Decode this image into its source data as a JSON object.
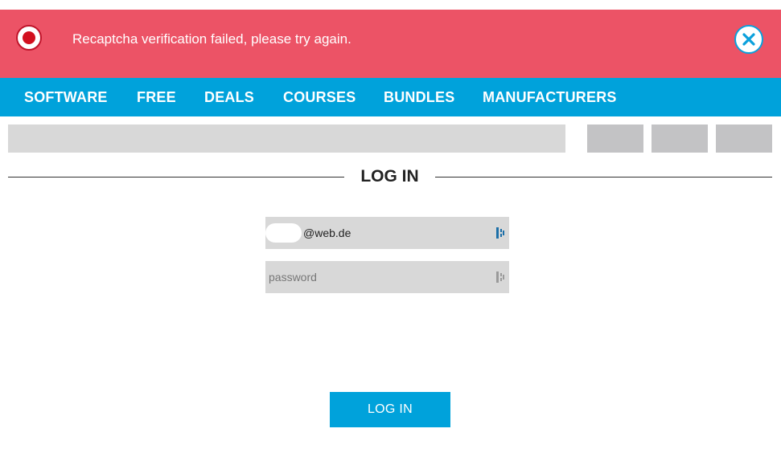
{
  "alert": {
    "message": "Recaptcha verification failed, please try again.",
    "icon": "error-record-icon",
    "close_icon": "close-x-icon",
    "background_color": "#ec5366"
  },
  "nav": {
    "items": [
      {
        "label": "SOFTWARE"
      },
      {
        "label": "FREE"
      },
      {
        "label": "DEALS"
      },
      {
        "label": "COURSES"
      },
      {
        "label": "BUNDLES"
      },
      {
        "label": "MANUFACTURERS"
      }
    ],
    "background_color": "#00a2db"
  },
  "login": {
    "heading": "LOG IN",
    "email_value": "@web.de",
    "password_placeholder": "password",
    "submit_label": "LOG IN",
    "field_icon": "password-manager-icon"
  }
}
